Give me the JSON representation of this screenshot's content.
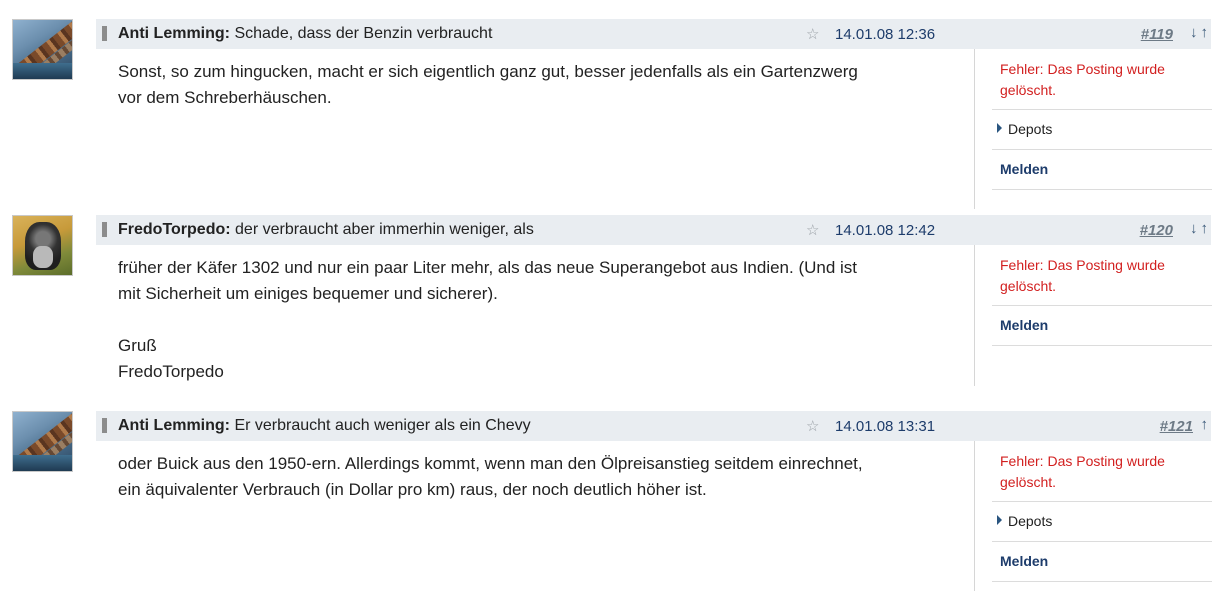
{
  "posts": [
    {
      "author": "Anti Lemming:",
      "subject": "Schade, dass der Benzin verbraucht",
      "date": "14.01.08 12:36",
      "number": "#119",
      "arrows": [
        "↓",
        "↑"
      ],
      "body": "Sonst, so zum hingucken, macht er sich eigentlich ganz gut, besser jedenfalls als ein Gartenzwerg\nvor dem Schreberhäuschen.",
      "sidebar": {
        "error": "Fehler: Das Posting wurde gelöscht.",
        "depots": "Depots",
        "melden": "Melden"
      }
    },
    {
      "author": "FredoTorpedo:",
      "subject": "der verbraucht aber immerhin weniger, als",
      "date": "14.01.08 12:42",
      "number": "#120",
      "arrows": [
        "↓",
        "↑"
      ],
      "body": "früher der Käfer 1302 und nur ein paar Liter mehr, als das neue Superangebot aus Indien. (Und ist\nmit Sicherheit um einiges bequemer und sicherer).\n\nGruß\nFredoTorpedo",
      "sidebar": {
        "error": "Fehler: Das Posting wurde gelöscht.",
        "melden": "Melden"
      }
    },
    {
      "author": "Anti Lemming:",
      "subject": "Er verbraucht auch weniger als ein Chevy",
      "date": "14.01.08 13:31",
      "number": "#121",
      "arrows": [
        "↑"
      ],
      "body": "oder Buick aus den 1950-ern. Allerdings kommt, wenn man den Ölpreisanstieg seitdem einrechnet,\nein äquivalenter Verbrauch (in Dollar pro km) raus, der noch deutlich höher ist.",
      "sidebar": {
        "error": "Fehler: Das Posting wurde gelöscht.",
        "depots": "Depots",
        "melden": "Melden"
      }
    }
  ],
  "icons": {
    "star": "☆",
    "flag": "bookmark-bar-icon",
    "avatar_1": "lemming-avatar",
    "avatar_2": "dog-avatar"
  },
  "colors": {
    "header_bg": "#e9edf1",
    "date": "#1d3c6b",
    "error": "#d21f1f",
    "melden": "#1d3c6b"
  }
}
